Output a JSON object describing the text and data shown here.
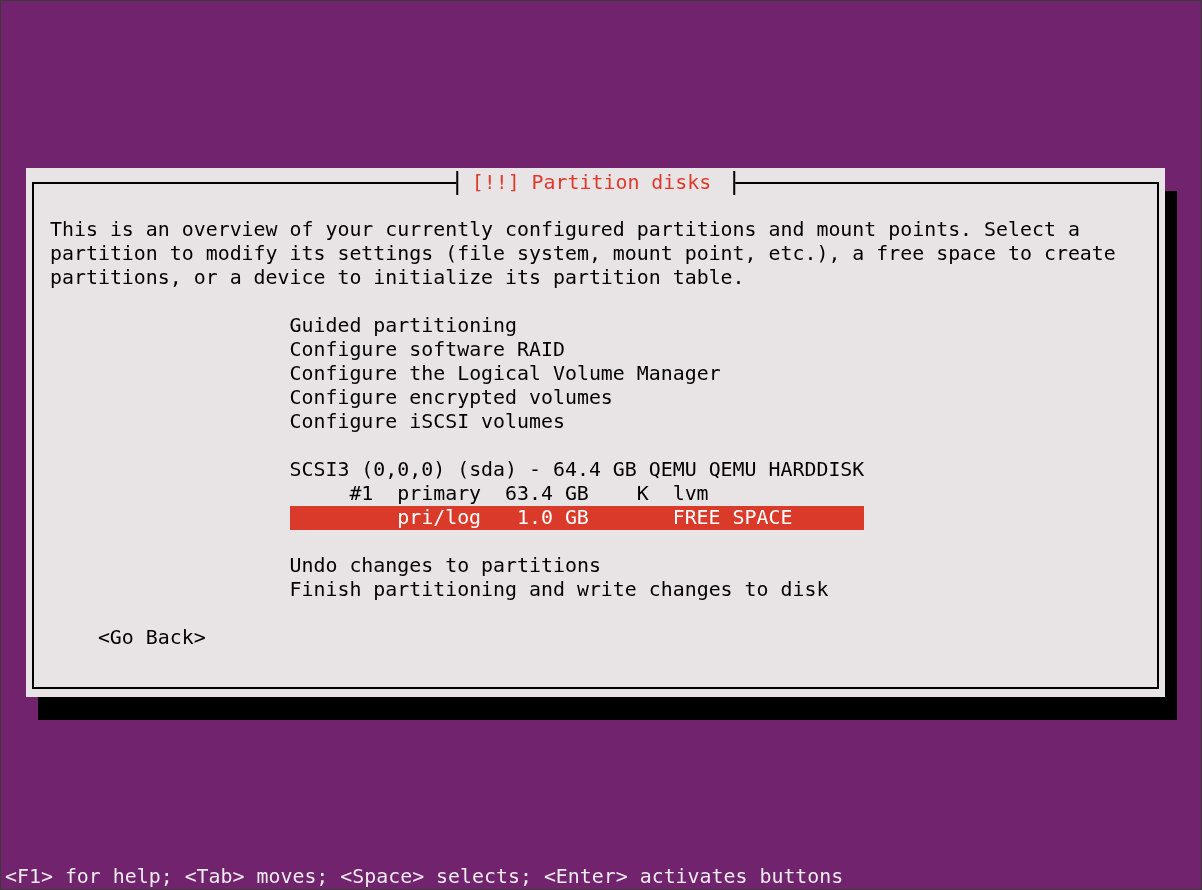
{
  "dialog": {
    "title": "[!!] Partition disks",
    "description": "This is an overview of your currently configured partitions and mount points. Select a partition to modify its settings (file system, mount point, etc.), a free space to create partitions, or a device to initialize its partition table.",
    "menu_items": [
      {
        "label": "Guided partitioning",
        "selected": false
      },
      {
        "label": "Configure software RAID",
        "selected": false
      },
      {
        "label": "Configure the Logical Volume Manager",
        "selected": false
      },
      {
        "label": "Configure encrypted volumes",
        "selected": false
      },
      {
        "label": "Configure iSCSI volumes",
        "selected": false
      }
    ],
    "disk": {
      "label": "SCSI3 (0,0,0) (sda) - 64.4 GB QEMU QEMU HARDDISK",
      "selected": false,
      "partitions": [
        {
          "number": "#1",
          "type": "primary",
          "size": "63.4 GB",
          "flags": "K",
          "file_system": "lvm",
          "selected": false
        },
        {
          "type": "pri/log",
          "size": "1.0 GB",
          "file_system": "FREE SPACE",
          "selected": true
        }
      ]
    },
    "final_items": [
      {
        "label": "Undo changes to partitions",
        "selected": false
      },
      {
        "label": "Finish partitioning and write changes to disk",
        "selected": false
      }
    ],
    "button": "<Go Back>"
  },
  "status_bar": "<F1> for help; <Tab> moves; <Space> selects; <Enter> activates buttons"
}
